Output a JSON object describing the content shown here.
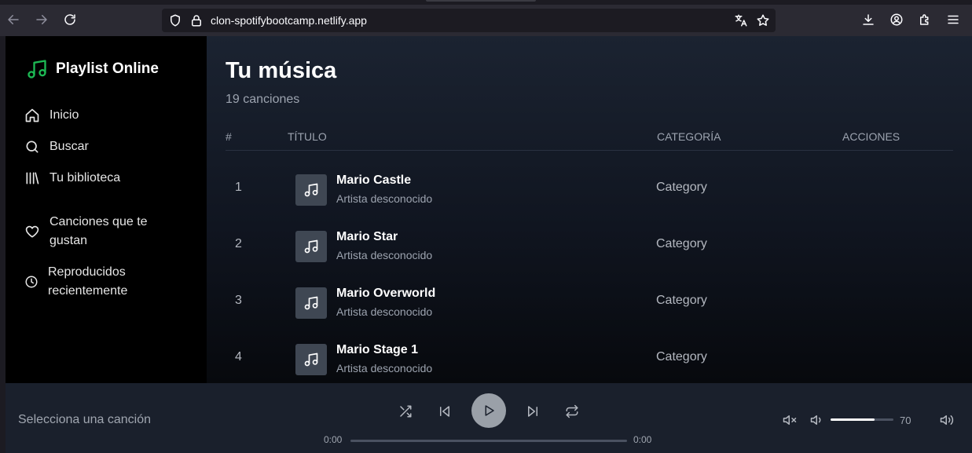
{
  "browser": {
    "url": "clon-spotifybootcamp.netlify.app"
  },
  "sidebar": {
    "logo_text": "Playlist Online",
    "accent_color": "#1db954",
    "items": [
      {
        "label": "Inicio",
        "icon": "home-icon"
      },
      {
        "label": "Buscar",
        "icon": "search-icon"
      },
      {
        "label": "Tu biblioteca",
        "icon": "library-icon"
      },
      {
        "label": "Canciones que te gustan",
        "icon": "heart-icon"
      },
      {
        "label": "Reproducidos recientemente",
        "icon": "clock-icon"
      }
    ]
  },
  "main": {
    "title": "Tu música",
    "song_count": "19 canciones",
    "columns": {
      "number": "#",
      "title": "TÍTULO",
      "category": "CATEGORÍA",
      "actions": "ACCIONES"
    },
    "rows": [
      {
        "num": "1",
        "title": "Mario Castle",
        "artist": "Artista desconocido",
        "category": "Category"
      },
      {
        "num": "2",
        "title": "Mario Star",
        "artist": "Artista desconocido",
        "category": "Category"
      },
      {
        "num": "3",
        "title": "Mario Overworld",
        "artist": "Artista desconocido",
        "category": "Category"
      },
      {
        "num": "4",
        "title": "Mario Stage 1",
        "artist": "Artista desconocido",
        "category": "Category"
      }
    ]
  },
  "player": {
    "now_playing": "Selecciona una canción",
    "current_time": "0:00",
    "total_time": "0:00",
    "progress": 0,
    "volume": "70"
  }
}
